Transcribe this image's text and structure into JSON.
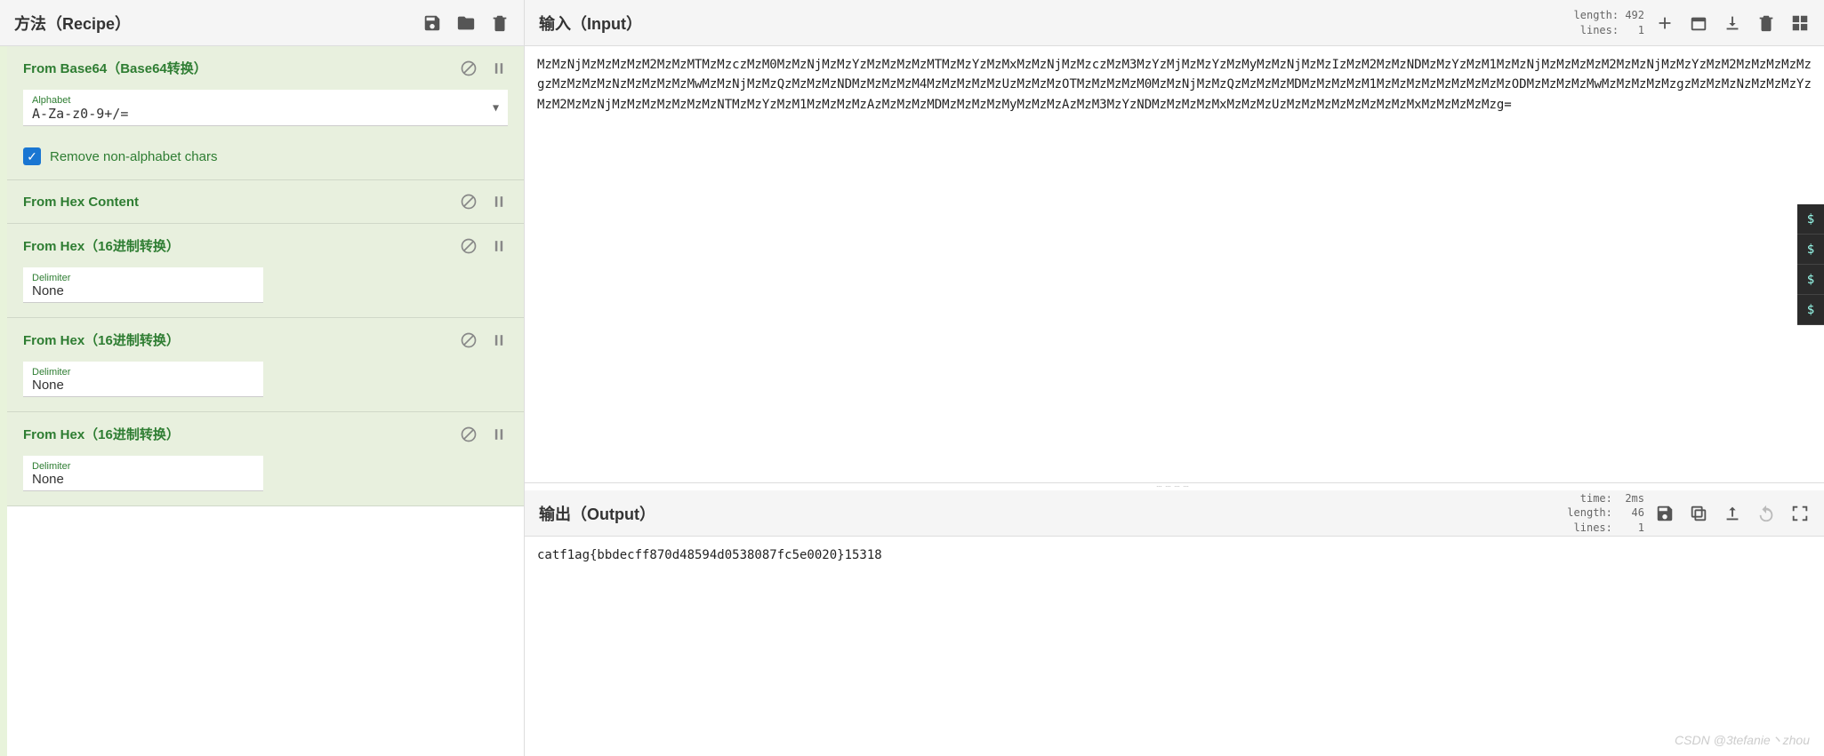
{
  "recipe": {
    "title": "方法（Recipe）",
    "icons": [
      "save",
      "folder",
      "trash"
    ],
    "operations": [
      {
        "name": "From Base64（Base64转换）",
        "fields": [
          {
            "type": "select",
            "label": "Alphabet",
            "value": "A-Za-z0-9+/="
          }
        ],
        "checkbox": {
          "checked": true,
          "label": "Remove non-alphabet chars"
        }
      },
      {
        "name": "From Hex Content",
        "fields": []
      },
      {
        "name": "From Hex（16进制转换）",
        "fields": [
          {
            "type": "small",
            "label": "Delimiter",
            "value": "None"
          }
        ]
      },
      {
        "name": "From Hex（16进制转换）",
        "fields": [
          {
            "type": "small",
            "label": "Delimiter",
            "value": "None"
          }
        ]
      },
      {
        "name": "From Hex（16进制转换）",
        "fields": [
          {
            "type": "small",
            "label": "Delimiter",
            "value": "None"
          }
        ]
      }
    ]
  },
  "input": {
    "title": "输入（Input）",
    "stats": "length: 492\n lines:   1",
    "icons": [
      "plus",
      "new-tab",
      "import",
      "trash",
      "grid"
    ],
    "text": "MzMzNjMzMzMzMzM2MzMzMTMzMzczMzM0MzMzNjMzMzYzMzMzMzMzMTMzMzYzMzMxMzMzNjMzMzczMzM3MzYzMjMzMzYzMzMyMzMzNjMzMzIzMzM2MzMzNDMzMzYzMzM1MzMzNjMzMzMzMzM2MzMzNjMzMzYzMzM2MzMzMzMzMzgzMzMzMzMzNzMzMzMzMzMwMzMzNjMzMzQzMzMzMzNDMzMzMzMzM4MzMzMzMzMzUzMzMzMzOTMzMzMzMzM0MzMzNjMzMzQzMzMzMzMDMzMzMzMzM1MzMzMzMzMzMzMzMzMzODMzMzMzMzMwMzMzMzMzMzgzMzMzMzNzMzMzMzYzMzM2MzMzNjMzMzMzMzMzMzMzNTMzMzYzMzM1MzMzMzMzAzMzMzMzMDMzMzMzMzMyMzMzMzAzMzM3MzYzNDMzMzMzMzMxMzMzMzUzMzMzMzMzMzMzMzMzMxMzMzMzMzMzg="
  },
  "output": {
    "title": "输出（Output）",
    "stats": "  time:  2ms\nlength:   46\n lines:    1",
    "icons": [
      "save",
      "copy",
      "replace",
      "undo",
      "fullscreen"
    ],
    "text": "catf1ag{bbdecff870d48594d0538087fc5e0020}15318"
  },
  "watermark": "CSDN @3tefanie丶zhou"
}
